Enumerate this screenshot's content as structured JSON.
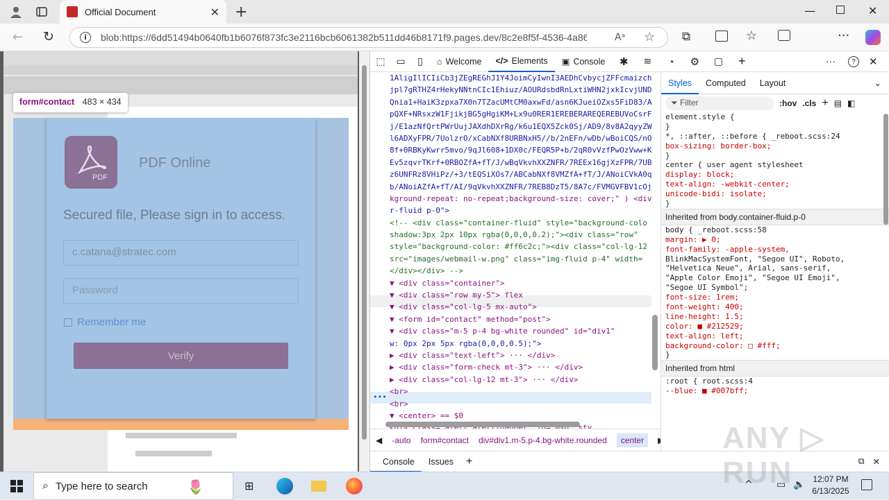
{
  "browser": {
    "tab_title": "Official Document",
    "url": "blob:https://6dd51494b0640fb1b6076f873fc3e2116bcb6061382b511dd46b8171f9.pages.dev/8c2e8f5f-4536-4a86-..."
  },
  "page": {
    "tooltip_tag": "form#contact",
    "tooltip_size": "483 × 434",
    "brand": "PDF Online",
    "pdf_badge": "PDF",
    "heading": "Secured file, Please sign in to access.",
    "email_value": "c.catana@stratec.com",
    "password_placeholder": "Password",
    "remember_label": "Remember me",
    "verify_label": "Verify"
  },
  "devtools": {
    "tabs": [
      "Welcome",
      "Elements",
      "Console"
    ],
    "elements_lines": [
      "1AligIlICIiCb3jZEgREGhJ1Y4JoimCyIwnI3AEDhCvbycjZFFcmaizch",
      "jpl7gRTHZ4rHekyNNtnCIc1Ehiuz/AOURdsbdRnLxtiWHN2jxkIcvjUND",
      "Qnia1+HaiK3zpxa7X0n7TZacUMtCM0axwFd/asn6KJueiOZxs5FiD83/A",
      "pQXF+NRsxzW1FjikjBG5gHgiKM+Lx9u0RER1EREBERAREQEREBUVoCsrF",
      "j/E1azNfQrtPWrUujJAXdhDXrRg/k6u1EQX5Zck0Sj/AD9/8v8A2qyyZW",
      "l6ADXyFPR/7UolzrO/xCabNXf8URBNxH5//b/2nEFn/wDb/wBoiCQS/nO",
      "8f+0RBKyKwrr5mvo/9qJl608+1DX0c/FEQR5P+b/2qR0vVzfPwOzVww+K",
      "Ev5zqvrTKrf+0RBOZfA+fT/J/wBqVkvhXXZNFR/7REEx16gjXzFPR/7UB",
      "z6UNFRz8VHiPz/+3/tEQSiXOs7/ABCabNXf8VMZfA+fT/J/ANoiCVkA0q",
      "b/ANoiAZfA+fT/AI/9qVkvhXXZNFR/7REB8DzT5/8A7c/FVMGVFBV1cOj",
      "kground-repeat: no-repeat;background-size: cover;\" ) <div",
      "r-fluid p-0\">",
      "  <!-- <div class=\"container-fluid\" style=\"background-colo",
      "  shadow:3px 2px 10px rgba(0,0,0,0.2);\"><div class=\"row\"",
      "  style=\"background-color: #ff6c2c;\"><div class=\"col-lg-12",
      "  src=\"images/webmail-w.png\" class=\"img-fluid p-4\" width=",
      "  </div></div> -->",
      "▼ <div class=\"container\">",
      "  ▼ <div class=\"row my-5\"> flex",
      "    ▼ <div class=\"col-lg-5 mx-auto\">",
      "      ▼ <form id=\"contact\" method=\"post\">",
      "        ▼ <div class=\"m-5 p-4 bg-white rounded\" id=\"div1\"",
      "          w: 0px 2px 5px rgba(0,0,0,0.5);\">",
      "          ▶ <div class=\"text-left\"> ··· </div>",
      "          ▶ <div class=\"form-check mt-3\"> ··· </div>",
      "          ▶ <div class=\"col-lg-12 mt-3\"> ··· </div>",
      "            <br>",
      "            <br>",
      "          ▼ <center> == $0",
      "              <div class=\"alert alert-danger\" id=\"msg\" sty"
    ],
    "breadcrumbs": [
      "-auto",
      "form#contact",
      "div#div1.m-5.p-4.bg-white.rounded",
      "center"
    ],
    "styles_tabs": [
      "Styles",
      "Computed",
      "Layout"
    ],
    "filter_placeholder": "Filter",
    "hov": ":hov",
    "cls": ".cls",
    "style_lines": [
      "element.style {",
      "}",
      "*, ::after, ::before {          _reboot.scss:24",
      "  box-sizing: border-box;",
      "}",
      "center {           user agent stylesheet",
      "  display: block;",
      "  text-align: -webkit-center;",
      "  unicode-bidi: isolate;",
      "}"
    ],
    "inherited_body": "Inherited from body.container-fluid.p-0",
    "body_lines": [
      "body {                          _reboot.scss:58",
      "  margin: ▶ 0;",
      "  font-family: -apple-system,",
      "      BlinkMacSystemFont, \"Segoe UI\", Roboto,",
      "      \"Helvetica Neue\", Arial, sans-serif,",
      "      \"Apple Color Emoji\", \"Segoe UI Emoji\",",
      "      \"Segoe UI Symbol\";",
      "  font-size: 1rem;",
      "  font-weight: 400;",
      "  line-height: 1.5;",
      "  color: ■ #212529;",
      "  text-align: left;",
      "  background-color: □ #fff;",
      "}"
    ],
    "inherited_html": "Inherited from html",
    "root_lines": [
      ":root {                          root.scss:4",
      "  --blue: ■ #007bff;"
    ],
    "drawer_tabs": [
      "Console",
      "Issues"
    ]
  },
  "taskbar": {
    "search_placeholder": "Type here to search",
    "time": "12:07 PM",
    "date": "6/13/2025"
  },
  "colors": {
    "overlay": "#a0c4e8",
    "verify_button": "#8b7195",
    "pdf_logo": "#8b7195",
    "accent": "#0a60d0"
  }
}
